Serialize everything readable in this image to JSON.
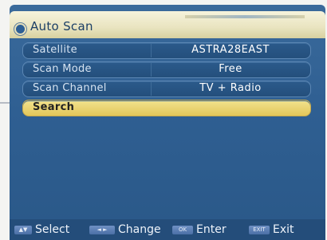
{
  "window": {
    "title": "Auto Scan"
  },
  "menu": {
    "items": [
      {
        "label": "Satellite",
        "value": "ASTRA28EAST"
      },
      {
        "label": "Scan Mode",
        "value": "Free"
      },
      {
        "label": "Scan Channel",
        "value": "TV + Radio"
      }
    ],
    "search_label": "Search"
  },
  "footer": {
    "hints": [
      {
        "key": "▲▼",
        "label": "Select"
      },
      {
        "key": "◄ ►",
        "label": "Change"
      },
      {
        "key": "OK",
        "label": "Enter"
      },
      {
        "key": "EXIT",
        "label": "Exit"
      }
    ]
  },
  "colors": {
    "background": "#2f5f92",
    "title_bar": "#ece6c4",
    "selected_row": "#ecd77c",
    "text": "#ffffff"
  },
  "icons": [
    "menu-bullet-icon",
    "up-down-arrows-icon",
    "left-right-arrows-icon",
    "ok-key-icon",
    "exit-key-icon"
  ]
}
